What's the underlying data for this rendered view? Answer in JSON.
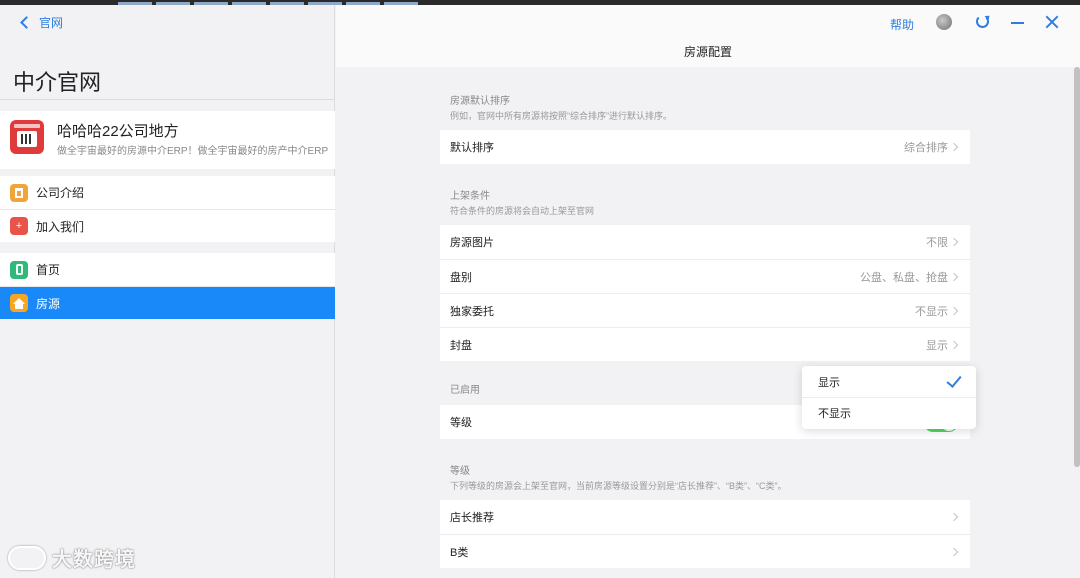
{
  "sidebar": {
    "back_label": "官网",
    "title": "中介官网",
    "company": {
      "name": "哈哈哈22公司地方",
      "desc": "做全宇宙最好的房源中介ERP！做全宇宙最好的房产中介ERP！…"
    },
    "group1": [
      {
        "label": "公司介绍",
        "icon": "building-icon"
      },
      {
        "label": "加入我们",
        "icon": "add-user-icon"
      }
    ],
    "group2": [
      {
        "label": "首页",
        "icon": "phone-icon"
      },
      {
        "label": "房源",
        "icon": "home-icon",
        "active": true
      }
    ]
  },
  "header": {
    "title": "房源配置",
    "help": "帮助"
  },
  "sections": {
    "sort": {
      "title": "房源默认排序",
      "note": "例如，官网中所有房源将按照“综合排序”进行默认排序。",
      "rows": [
        {
          "label": "默认排序",
          "value": "综合排序"
        }
      ]
    },
    "listing": {
      "title": "上架条件",
      "note": "符合条件的房源将会自动上架至官网",
      "rows": [
        {
          "label": "房源图片",
          "value": "不限"
        },
        {
          "label": "盘别",
          "value": "公盘、私盘、抢盘"
        },
        {
          "label": "独家委托",
          "value": "不显示"
        },
        {
          "label": "封盘",
          "value": "显示"
        }
      ]
    },
    "enabled": {
      "title": "已启用",
      "rows": [
        {
          "label": "等级",
          "toggle": true
        }
      ]
    },
    "level": {
      "title": "等级",
      "note": "下列等级的房源会上架至官网，当前房源等级设置分别是“店长推荐”、“B类”、“C类”。",
      "rows": [
        {
          "label": "店长推荐"
        },
        {
          "label": "B类"
        }
      ]
    }
  },
  "popup": {
    "options": [
      {
        "label": "显示",
        "selected": true
      },
      {
        "label": "不显示",
        "selected": false
      }
    ]
  },
  "watermark": "大数跨境",
  "colors": {
    "accent": "#2f7de1",
    "active": "#1989fa",
    "toggle_on": "#4cd964"
  }
}
